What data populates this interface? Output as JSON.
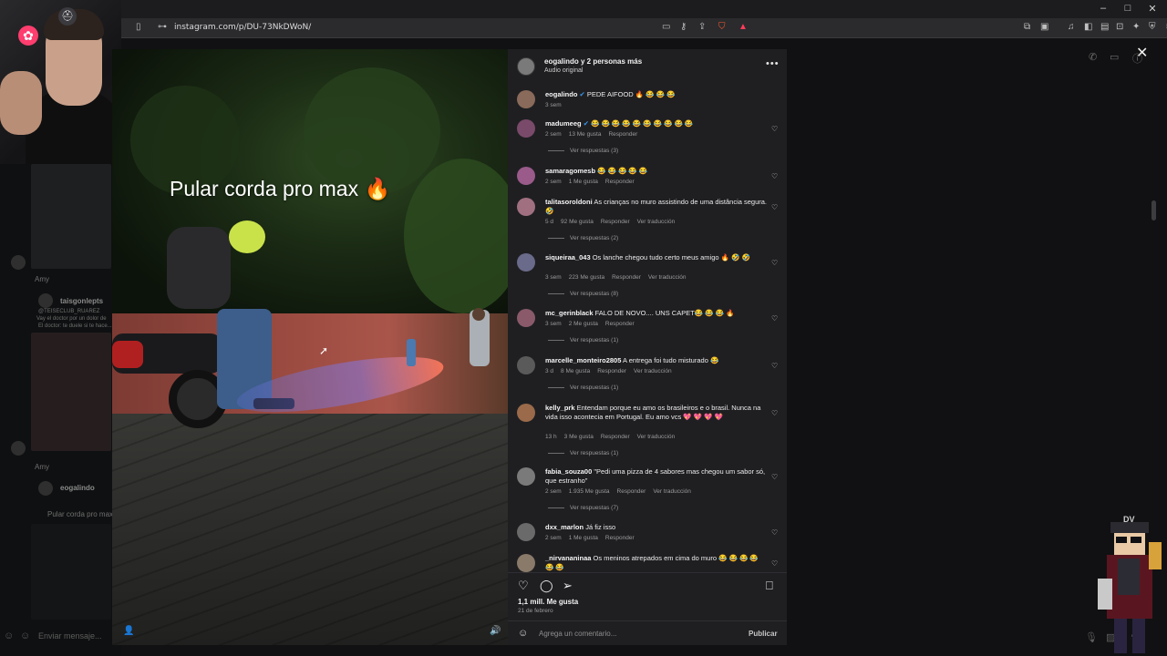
{
  "browser": {
    "url": "instagram.com/p/DU-73NkDWoN/",
    "win_minimize": "–",
    "win_maximize": "□",
    "win_close": "✕"
  },
  "stream": {
    "chat_placeholder": "Enviar mensaje..."
  },
  "post": {
    "header_title": "eogalindo y 2 personas más",
    "header_subtitle": "Audio original",
    "more_label": "•••",
    "caption_overlay": "Pular corda pro max",
    "caption_emoji": "🔥",
    "likes": "1,1 mill. Me gusta",
    "date": "21 de febrero",
    "comment_placeholder": "Agrega un comentario...",
    "publish_label": "Publicar",
    "close_label": "✕"
  },
  "comments": [
    {
      "user": "eogalindo",
      "verified": true,
      "text": "PEDE AIFOOD 🔥 😂 😂 😂",
      "time": "3 sem",
      "likes": "",
      "reply": "",
      "translate": "",
      "replies": ""
    },
    {
      "user": "madumeeg",
      "verified": true,
      "text": "😂 😂 😂 😂 😂 😂 😂 😂 😂 😂",
      "time": "2 sem",
      "likes": "13 Me gusta",
      "reply": "Responder",
      "translate": "",
      "replies": "Ver respuestas (3)"
    },
    {
      "user": "samaragomesb",
      "verified": false,
      "text": "😂 😂 😂 😂 😂",
      "time": "2 sem",
      "likes": "1 Me gusta",
      "reply": "Responder",
      "translate": "",
      "replies": ""
    },
    {
      "user": "talitasoroldoni",
      "verified": false,
      "text": "As crianças no muro assistindo de uma distância segura. 🤣",
      "time": "5 d",
      "likes": "92 Me gusta",
      "reply": "Responder",
      "translate": "Ver traducción",
      "replies": "Ver respuestas (2)"
    },
    {
      "user": "siqueiraa_043",
      "verified": false,
      "text": "Os lanche chegou tudo certo meus amigo 🔥 🤣 🤣",
      "time": "3 sem",
      "likes": "223 Me gusta",
      "reply": "Responder",
      "translate": "Ver traducción",
      "replies": "Ver respuestas (8)"
    },
    {
      "user": "mc_gerinblack",
      "verified": false,
      "text": "FALO DE NOVO.... UNS CAPET😂 😂 😂 🔥",
      "time": "3 sem",
      "likes": "2 Me gusta",
      "reply": "Responder",
      "translate": "",
      "replies": "Ver respuestas (1)"
    },
    {
      "user": "marcelle_monteiro2805",
      "verified": false,
      "text": "A entrega foi tudo misturado 😂",
      "time": "3 d",
      "likes": "8 Me gusta",
      "reply": "Responder",
      "translate": "Ver traducción",
      "replies": "Ver respuestas (1)"
    },
    {
      "user": "kelly_prk",
      "verified": false,
      "text": "Entendam porque eu amo os brasileiros e o brasil. Nunca na vida isso acontecia em Portugal. Eu amo vcs 💖 💖 💖 💖",
      "time": "13 h",
      "likes": "3 Me gusta",
      "reply": "Responder",
      "translate": "Ver traducción",
      "replies": "Ver respuestas (1)"
    },
    {
      "user": "fabia_souza00",
      "verified": false,
      "text": "\"Pedi uma pizza de 4 sabores mas chegou um sabor só, que estranho\"",
      "time": "2 sem",
      "likes": "1.935 Me gusta",
      "reply": "Responder",
      "translate": "Ver traducción",
      "replies": "Ver respuestas (7)"
    },
    {
      "user": "dxx_marlon",
      "verified": false,
      "text": "Já fiz isso",
      "time": "2 sem",
      "likes": "1 Me gusta",
      "reply": "Responder",
      "translate": "",
      "replies": ""
    },
    {
      "user": "_nirvananinaa",
      "verified": false,
      "text": "Os meninos atrepados em cima do muro 😂 😂 😂 😂 😂 😂",
      "time": "",
      "likes": "",
      "reply": "",
      "translate": "",
      "replies": ""
    }
  ],
  "left_overlay": {
    "label1": "Amy",
    "name1": "taisgonlepts",
    "sub1": "@TEISECLUB_RUAREZ",
    "sub2": "Vay el doctor por un dolor de",
    "sub3": "El doctor: te duele si te hace...",
    "label2": "Amy",
    "name2": "eogalindo",
    "caption2": "Pular corda pro max"
  },
  "mascot": {
    "label": "DV"
  },
  "colors": {
    "panel_bg": "#1f1f22",
    "accent_verified": "#3897f0",
    "fire": "#ff6a1a"
  }
}
